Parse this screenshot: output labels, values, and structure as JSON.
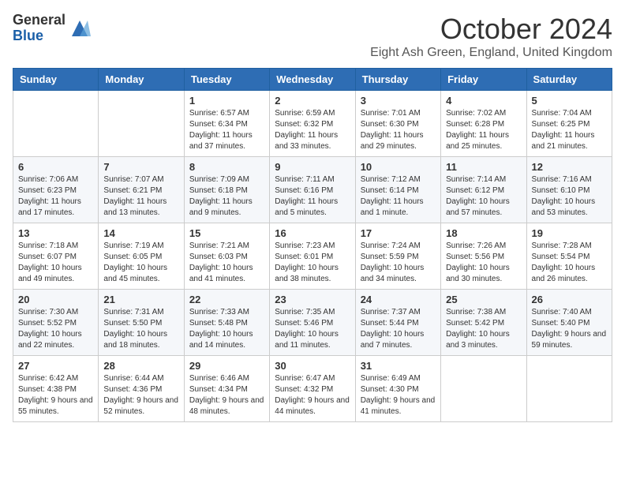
{
  "logo": {
    "general": "General",
    "blue": "Blue"
  },
  "title": "October 2024",
  "location": "Eight Ash Green, England, United Kingdom",
  "days_of_week": [
    "Sunday",
    "Monday",
    "Tuesday",
    "Wednesday",
    "Thursday",
    "Friday",
    "Saturday"
  ],
  "weeks": [
    [
      {
        "day": "",
        "info": ""
      },
      {
        "day": "",
        "info": ""
      },
      {
        "day": "1",
        "info": "Sunrise: 6:57 AM\nSunset: 6:34 PM\nDaylight: 11 hours and 37 minutes."
      },
      {
        "day": "2",
        "info": "Sunrise: 6:59 AM\nSunset: 6:32 PM\nDaylight: 11 hours and 33 minutes."
      },
      {
        "day": "3",
        "info": "Sunrise: 7:01 AM\nSunset: 6:30 PM\nDaylight: 11 hours and 29 minutes."
      },
      {
        "day": "4",
        "info": "Sunrise: 7:02 AM\nSunset: 6:28 PM\nDaylight: 11 hours and 25 minutes."
      },
      {
        "day": "5",
        "info": "Sunrise: 7:04 AM\nSunset: 6:25 PM\nDaylight: 11 hours and 21 minutes."
      }
    ],
    [
      {
        "day": "6",
        "info": "Sunrise: 7:06 AM\nSunset: 6:23 PM\nDaylight: 11 hours and 17 minutes."
      },
      {
        "day": "7",
        "info": "Sunrise: 7:07 AM\nSunset: 6:21 PM\nDaylight: 11 hours and 13 minutes."
      },
      {
        "day": "8",
        "info": "Sunrise: 7:09 AM\nSunset: 6:18 PM\nDaylight: 11 hours and 9 minutes."
      },
      {
        "day": "9",
        "info": "Sunrise: 7:11 AM\nSunset: 6:16 PM\nDaylight: 11 hours and 5 minutes."
      },
      {
        "day": "10",
        "info": "Sunrise: 7:12 AM\nSunset: 6:14 PM\nDaylight: 11 hours and 1 minute."
      },
      {
        "day": "11",
        "info": "Sunrise: 7:14 AM\nSunset: 6:12 PM\nDaylight: 10 hours and 57 minutes."
      },
      {
        "day": "12",
        "info": "Sunrise: 7:16 AM\nSunset: 6:10 PM\nDaylight: 10 hours and 53 minutes."
      }
    ],
    [
      {
        "day": "13",
        "info": "Sunrise: 7:18 AM\nSunset: 6:07 PM\nDaylight: 10 hours and 49 minutes."
      },
      {
        "day": "14",
        "info": "Sunrise: 7:19 AM\nSunset: 6:05 PM\nDaylight: 10 hours and 45 minutes."
      },
      {
        "day": "15",
        "info": "Sunrise: 7:21 AM\nSunset: 6:03 PM\nDaylight: 10 hours and 41 minutes."
      },
      {
        "day": "16",
        "info": "Sunrise: 7:23 AM\nSunset: 6:01 PM\nDaylight: 10 hours and 38 minutes."
      },
      {
        "day": "17",
        "info": "Sunrise: 7:24 AM\nSunset: 5:59 PM\nDaylight: 10 hours and 34 minutes."
      },
      {
        "day": "18",
        "info": "Sunrise: 7:26 AM\nSunset: 5:56 PM\nDaylight: 10 hours and 30 minutes."
      },
      {
        "day": "19",
        "info": "Sunrise: 7:28 AM\nSunset: 5:54 PM\nDaylight: 10 hours and 26 minutes."
      }
    ],
    [
      {
        "day": "20",
        "info": "Sunrise: 7:30 AM\nSunset: 5:52 PM\nDaylight: 10 hours and 22 minutes."
      },
      {
        "day": "21",
        "info": "Sunrise: 7:31 AM\nSunset: 5:50 PM\nDaylight: 10 hours and 18 minutes."
      },
      {
        "day": "22",
        "info": "Sunrise: 7:33 AM\nSunset: 5:48 PM\nDaylight: 10 hours and 14 minutes."
      },
      {
        "day": "23",
        "info": "Sunrise: 7:35 AM\nSunset: 5:46 PM\nDaylight: 10 hours and 11 minutes."
      },
      {
        "day": "24",
        "info": "Sunrise: 7:37 AM\nSunset: 5:44 PM\nDaylight: 10 hours and 7 minutes."
      },
      {
        "day": "25",
        "info": "Sunrise: 7:38 AM\nSunset: 5:42 PM\nDaylight: 10 hours and 3 minutes."
      },
      {
        "day": "26",
        "info": "Sunrise: 7:40 AM\nSunset: 5:40 PM\nDaylight: 9 hours and 59 minutes."
      }
    ],
    [
      {
        "day": "27",
        "info": "Sunrise: 6:42 AM\nSunset: 4:38 PM\nDaylight: 9 hours and 55 minutes."
      },
      {
        "day": "28",
        "info": "Sunrise: 6:44 AM\nSunset: 4:36 PM\nDaylight: 9 hours and 52 minutes."
      },
      {
        "day": "29",
        "info": "Sunrise: 6:46 AM\nSunset: 4:34 PM\nDaylight: 9 hours and 48 minutes."
      },
      {
        "day": "30",
        "info": "Sunrise: 6:47 AM\nSunset: 4:32 PM\nDaylight: 9 hours and 44 minutes."
      },
      {
        "day": "31",
        "info": "Sunrise: 6:49 AM\nSunset: 4:30 PM\nDaylight: 9 hours and 41 minutes."
      },
      {
        "day": "",
        "info": ""
      },
      {
        "day": "",
        "info": ""
      }
    ]
  ]
}
